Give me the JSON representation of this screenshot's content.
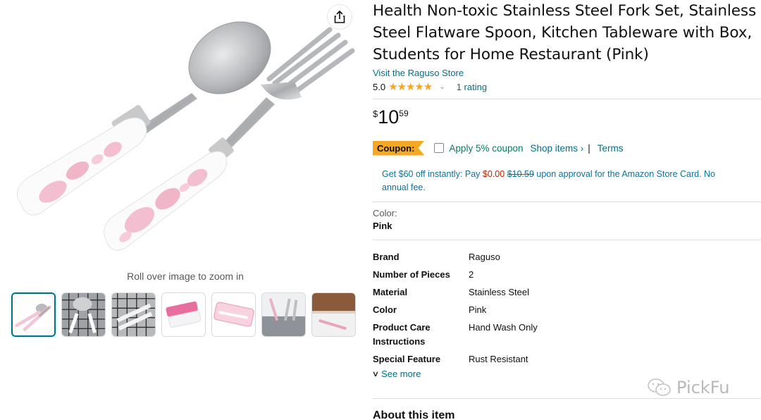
{
  "product": {
    "title": "Health Non-toxic Stainless Steel Fork Set, Stainless Steel Flatware Spoon, Kitchen Tableware with Box, Students for Home Restaurant (Pink)",
    "store_link": "Visit the Raguso Store",
    "rating_value": "5.0",
    "stars_glyphs": "★★★★★",
    "rating_count": "1 rating",
    "price_symbol": "$",
    "price_whole": "10",
    "price_fraction": "59"
  },
  "coupon": {
    "badge": "Coupon:",
    "apply_text": "Apply 5% coupon",
    "shop_items": "Shop items ›",
    "separator": "|",
    "terms": "Terms"
  },
  "card_offer": {
    "prefix": "Get $60 off instantly: Pay ",
    "new_price": "$0.00",
    "old_price": "$10.59",
    "suffix": " upon approval for the Amazon Store Card. No annual fee."
  },
  "color": {
    "label": "Color:",
    "value": "Pink"
  },
  "specs": [
    {
      "key": "Brand",
      "value": "Raguso"
    },
    {
      "key": "Number of Pieces",
      "value": "2"
    },
    {
      "key": "Material",
      "value": "Stainless Steel"
    },
    {
      "key": "Color",
      "value": "Pink"
    },
    {
      "key": "Product Care Instructions",
      "value": "Hand Wash Only"
    },
    {
      "key": "Special Feature",
      "value": "Rust Resistant"
    }
  ],
  "see_more": "See more",
  "about_heading": "About this item",
  "gallery": {
    "zoom_hint": "Roll over image to zoom in",
    "thumbnail_count": 7
  },
  "watermark": "PickFu",
  "colors": {
    "link": "#007185",
    "coupon_badge": "#f7a823",
    "coupon_text": "#067d62",
    "price_red": "#b12704",
    "star": "#ffa41c",
    "thumb_active": "#007185"
  }
}
